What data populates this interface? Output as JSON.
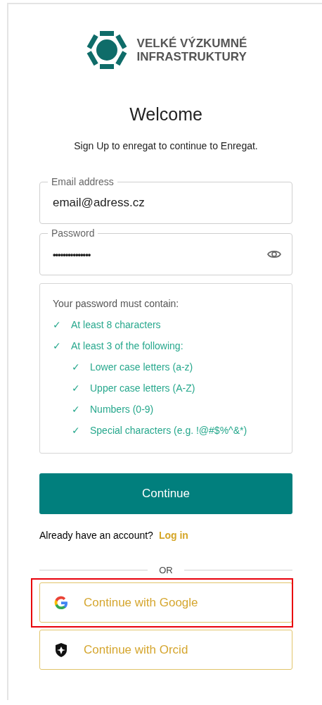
{
  "logo": {
    "line_1": "VELKÉ VÝZKUMNÉ",
    "line_2": "INFRASTRUKTURY"
  },
  "title": "Welcome",
  "subtitle": "Sign Up to enregat to continue to Enregat.",
  "fields": [
    {
      "label": "Email address",
      "value": "email@adress.cz",
      "kind": "text"
    },
    {
      "label": "Password",
      "value": "•••••••••••••••",
      "kind": "password"
    }
  ],
  "requirements": {
    "heading": "Your password must contain:",
    "items": [
      {
        "mark": "✓",
        "text": "At least 8 characters",
        "met": true
      },
      {
        "mark": "✓",
        "text": "At least 3 of the following:",
        "met": true,
        "children": [
          {
            "mark": "✓",
            "text": "Lower case letters (a-z)",
            "met": true
          },
          {
            "mark": "✓",
            "text": "Upper case letters (A-Z)",
            "met": true
          },
          {
            "mark": "✓",
            "text": "Numbers (0-9)",
            "met": true
          },
          {
            "mark": "✓",
            "text": "Special characters (e.g. !@#$%^&*)",
            "met": true
          }
        ]
      }
    ]
  },
  "continue_button": "Continue",
  "login_prompt": {
    "text": "Already have an account?",
    "link": "Log in"
  },
  "divider": "OR",
  "social_buttons": [
    {
      "label": "Continue with Google",
      "kind": "google",
      "highlighted": true
    },
    {
      "label": "Continue with Orcid",
      "kind": "orcid",
      "highlighted": false
    }
  ]
}
